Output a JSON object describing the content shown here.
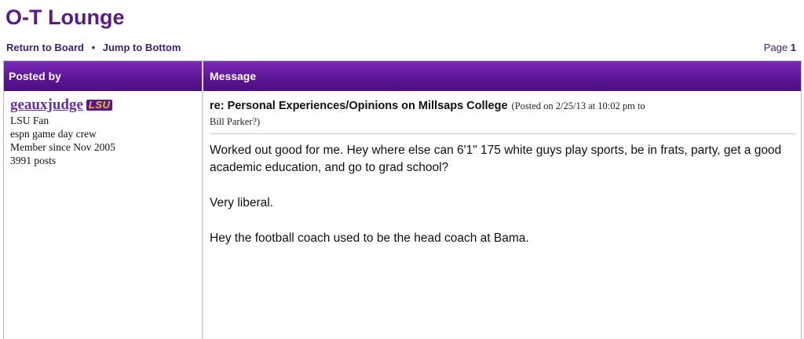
{
  "board": {
    "title": "O-T Lounge"
  },
  "nav": {
    "return_label": "Return to Board",
    "separator": "•",
    "jump_label": "Jump to Bottom",
    "page_label": "Page",
    "page_number": "1"
  },
  "table": {
    "col_posted_by": "Posted by",
    "col_message": "Message"
  },
  "post": {
    "author": {
      "username": "geauxjudge",
      "team_logo": "LSU",
      "fan_of": "LSU Fan",
      "title": "espn game day crew",
      "member_since": "Member since Nov 2005",
      "posts": "3991 posts"
    },
    "subject": "re: Personal Experiences/Opinions on Millsaps College",
    "posted_on": "(Posted on 2/25/13 at 10:02 pm to",
    "posted_to": "Bill Parker?)",
    "body": [
      "Worked out good for me. Hey where else can 6'1\" 175 white guys play sports, be in frats, party, get a good academic education, and go to grad school?",
      "Very liberal.",
      "Hey the football coach used to be the head coach at Bama."
    ]
  },
  "colors": {
    "header_purple": "#5d1697",
    "title_purple": "#5a1a8c",
    "link_purple": "#3c1f78",
    "lsu_gold": "#f4b82a"
  }
}
